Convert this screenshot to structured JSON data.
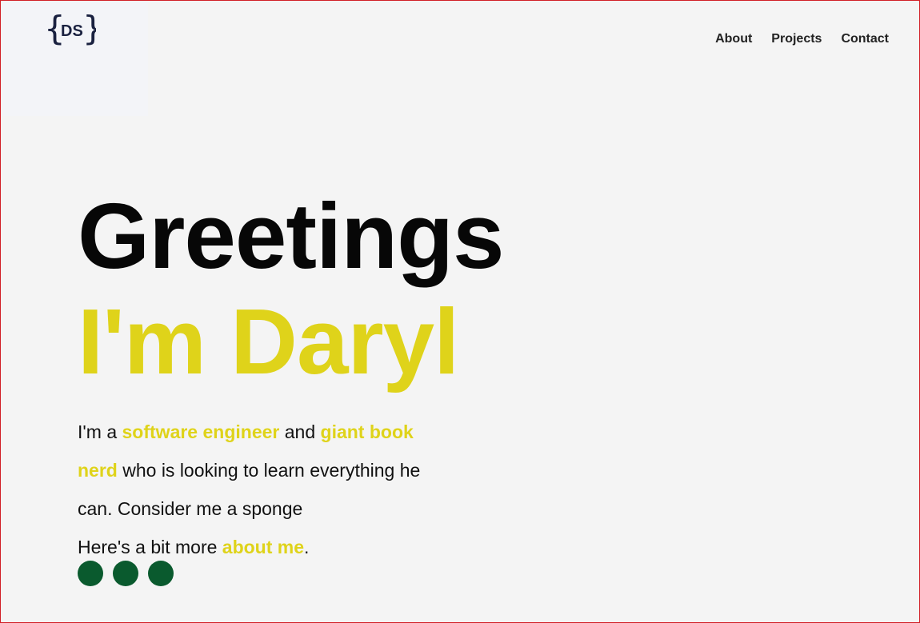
{
  "logo": {
    "text": "DS",
    "brace_left": "{",
    "brace_right": "}"
  },
  "nav": {
    "items": [
      "About",
      "Projects",
      "Contact"
    ]
  },
  "hero": {
    "title": "Greetings",
    "subtitle": "I'm Daryl",
    "bio": {
      "p1": "I'm a ",
      "accent1": "software engineer",
      "p2": " and ",
      "accent2": "giant book nerd",
      "p3": " who is looking to learn everything he can. Consider me a sponge"
    },
    "more": {
      "prefix": "Here's a bit more ",
      "link": "about me",
      "suffix": "."
    }
  },
  "carousel": {
    "dots": 3
  },
  "colors": {
    "accent": "#dfd31a",
    "dark": "#070707",
    "dot": "#0a5a2e",
    "frame": "#d11f26"
  }
}
